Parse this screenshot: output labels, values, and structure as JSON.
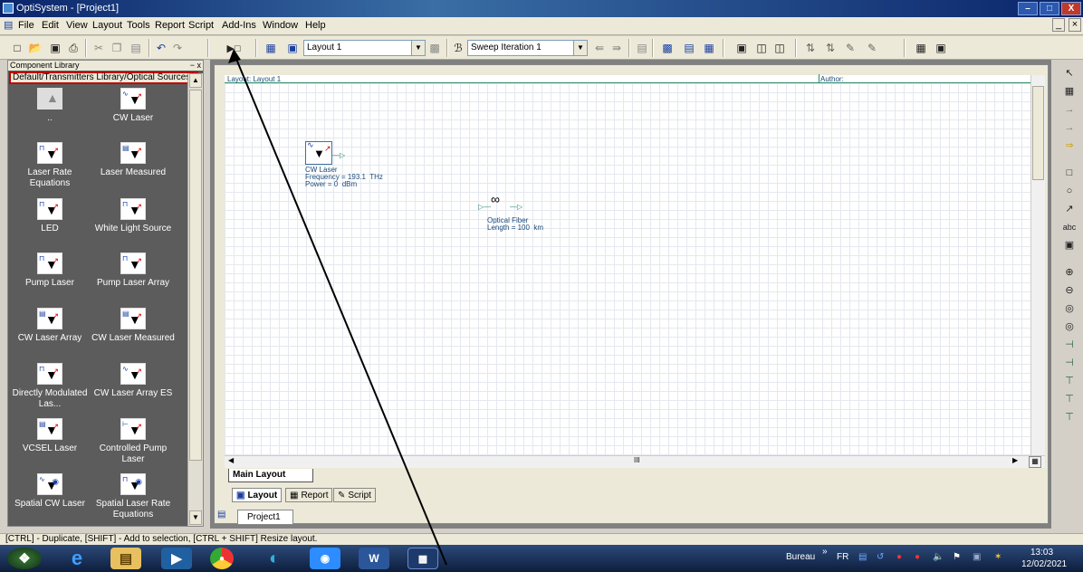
{
  "window": {
    "title": "OptiSystem - [Project1]",
    "controls": [
      "–",
      "□",
      "X"
    ]
  },
  "menu": {
    "doc_icon": "▤",
    "items": [
      "File",
      "Edit",
      "View",
      "Layout",
      "Tools",
      "Report",
      "Script",
      "Add-Ins",
      "Window",
      "Help"
    ],
    "mdi_controls": [
      "_",
      "×"
    ]
  },
  "toolbar": {
    "layout_select": "Layout 1",
    "sweep_select": "Sweep Iteration 1",
    "icons": [
      "new-icon",
      "open-icon",
      "save-icon",
      "print-icon",
      "cut-icon",
      "copy-icon",
      "paste-icon",
      "undo-icon",
      "redo-icon",
      "run-icon",
      "layout-icon",
      "parameter-icon",
      "sweep-icon",
      "grid-icon",
      "report-icon",
      "export-icon"
    ]
  },
  "component_library": {
    "header": "Component Library",
    "close": "− x",
    "path": "Default/Transmitters Library/Optical Sources/",
    "items": [
      {
        "label": "..",
        "icon": "folder-up-icon"
      },
      {
        "label": "CW Laser",
        "icon": "cw-laser-icon"
      },
      {
        "label": "Laser Rate Equations",
        "icon": "laser-rate-icon"
      },
      {
        "label": "Laser Measured",
        "icon": "laser-measured-icon"
      },
      {
        "label": "LED",
        "icon": "led-icon"
      },
      {
        "label": "White Light Source",
        "icon": "white-light-icon"
      },
      {
        "label": "Pump Laser",
        "icon": "pump-laser-icon"
      },
      {
        "label": "Pump Laser Array",
        "icon": "pump-laser-array-icon"
      },
      {
        "label": "CW Laser Array",
        "icon": "cw-laser-array-icon"
      },
      {
        "label": "CW Laser Measured",
        "icon": "cw-laser-measured-icon"
      },
      {
        "label": "Directly Modulated Las...",
        "icon": "direct-mod-laser-icon"
      },
      {
        "label": "CW Laser Array ES",
        "icon": "cw-laser-array-es-icon"
      },
      {
        "label": "VCSEL Laser",
        "icon": "vcsel-icon"
      },
      {
        "label": "Controlled Pump Laser",
        "icon": "controlled-pump-icon"
      },
      {
        "label": "Spatial CW Laser",
        "icon": "spatial-cw-icon"
      },
      {
        "label": "Spatial Laser Rate Equations",
        "icon": "spatial-rate-icon"
      }
    ]
  },
  "layout": {
    "header_title": "Layout: Layout 1",
    "header_author": "Author:",
    "components": [
      {
        "name": "CW Laser",
        "params": "Frequency = 193.1  THz\nPower = 0  dBm"
      },
      {
        "name": "Optical Fiber",
        "params": "Length = 100  km"
      }
    ],
    "hscroll_label": "III",
    "tab": "Main Layout"
  },
  "view_tabs": [
    "Layout",
    "Report",
    "Script"
  ],
  "project_tab": "Project1",
  "status": "[CTRL] - Duplicate, [SHIFT] - Add to selection, [CTRL + SHIFT] Resize layout.",
  "taskbar": {
    "bureau": "Bureau",
    "lang": "FR",
    "time": "13:03",
    "date": "12/02/2021"
  }
}
